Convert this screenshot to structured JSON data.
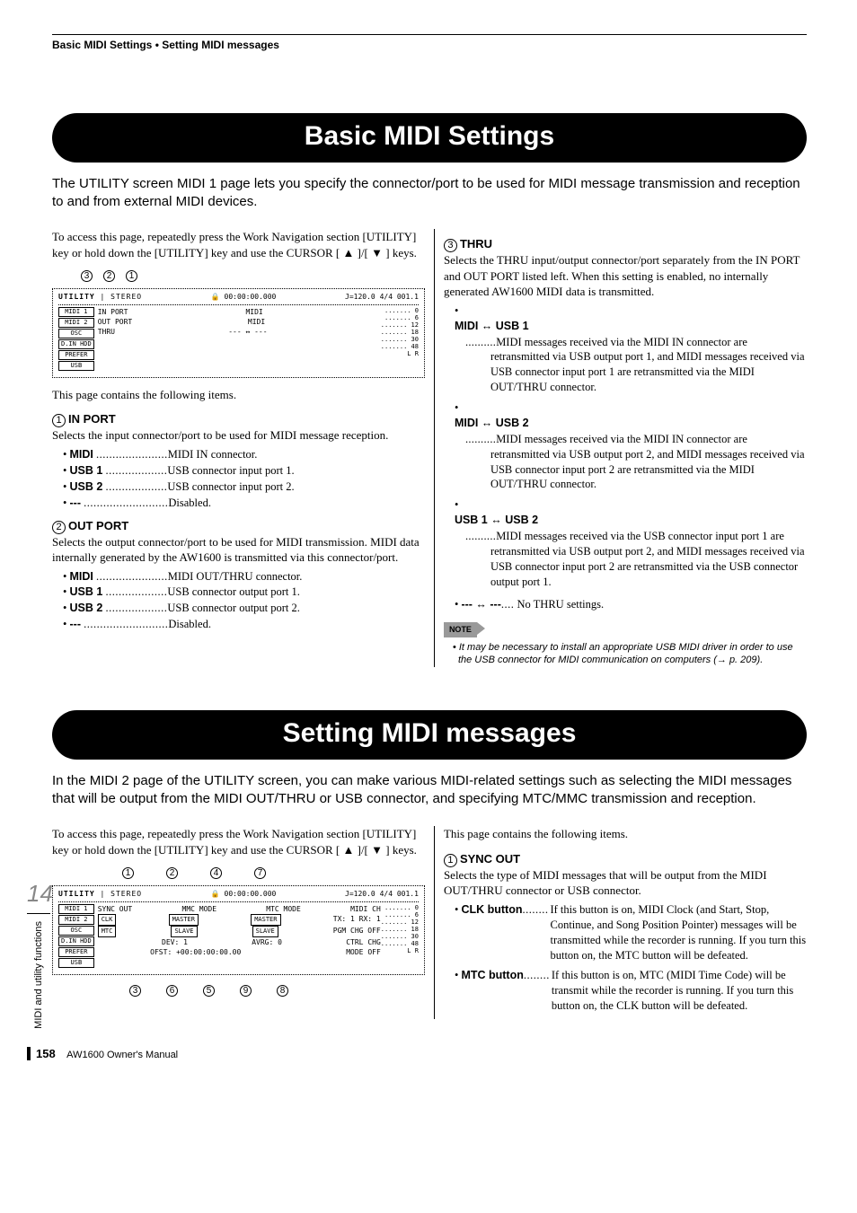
{
  "header": {
    "breadcrumb": "Basic MIDI Settings  •  Setting MIDI messages"
  },
  "chapter": {
    "number": "14",
    "label": "MIDI and utility functions"
  },
  "footer": {
    "page": "158",
    "manual": "AW1600 Owner's Manual"
  },
  "section1": {
    "title": "Basic MIDI Settings",
    "intro": "The UTILITY screen MIDI 1 page lets you specify the connector/port to be used for MIDI message transmission and reception to and from external MIDI devices.",
    "left": {
      "access": "To access this page, repeatedly press the Work Navigation section [UTILITY] key or hold down the [UTILITY] key and use the CURSOR [ ▲ ]/[ ▼ ] keys.",
      "callouts_top": [
        "3",
        "2",
        "1"
      ],
      "ss": {
        "title_left": "UTILITY",
        "title_mid": "STEREO",
        "title_time": "00:00:00.000",
        "title_right": "J=120.0 4/4 001.1",
        "tabs": [
          "MIDI 1",
          "MIDI 2",
          "OSC",
          "D.IN HDD",
          "PREFER",
          "USB"
        ],
        "rows": [
          [
            "IN PORT",
            "MIDI"
          ],
          [
            "OUT PORT",
            "MIDI"
          ],
          [
            "THRU",
            "---   ↔   ---"
          ]
        ],
        "meters": [
          "0",
          "6",
          "12",
          "18",
          "30",
          "48",
          "L R"
        ]
      },
      "after_ss": "This page contains the following items.",
      "items": [
        {
          "num": "1",
          "name": "IN PORT",
          "desc": "Selects the input connector/port to be used for MIDI message reception.",
          "dl": [
            {
              "term": "MIDI",
              "dots": "......................",
              "def": "MIDI IN connector."
            },
            {
              "term": "USB 1",
              "dots": "...................",
              "def": "USB connector input port 1."
            },
            {
              "term": "USB 2",
              "dots": "...................",
              "def": "USB connector input port 2."
            },
            {
              "term": "---",
              "dots": "..........................",
              "def": "Disabled."
            }
          ]
        },
        {
          "num": "2",
          "name": "OUT PORT",
          "desc": "Selects the output connector/port to be used for MIDI transmission. MIDI data internally generated by the AW1600 is transmitted via this connector/port.",
          "dl": [
            {
              "term": "MIDI",
              "dots": "......................",
              "def": "MIDI OUT/THRU connector."
            },
            {
              "term": "USB 1",
              "dots": "...................",
              "def": "USB connector output port 1."
            },
            {
              "term": "USB 2",
              "dots": "...................",
              "def": "USB connector output port 2."
            },
            {
              "term": "---",
              "dots": "..........................",
              "def": "Disabled."
            }
          ]
        }
      ]
    },
    "right": {
      "item": {
        "num": "3",
        "name": "THRU",
        "desc": "Selects the THRU input/output connector/port separately from the IN PORT and OUT PORT listed left. When this setting is enabled, no internally generated AW1600 MIDI data is transmitted.",
        "nested": [
          {
            "term": "MIDI ↔ USB 1",
            "def": "MIDI messages received via the MIDI IN connector are retransmitted via USB output port 1, and MIDI messages received via USB connector input port 1 are retransmitted via the MIDI OUT/THRU connector."
          },
          {
            "term": "MIDI ↔ USB 2",
            "def": "MIDI messages received via the MIDI IN connector are retransmitted via USB output port 2, and MIDI messages received via USB connector input port 2 are retransmitted via the MIDI OUT/THRU connector."
          },
          {
            "term": "USB 1 ↔ USB 2",
            "def": "MIDI messages received via the USB connector input port 1 are retransmitted via USB output port 2, and MIDI messages received via USB connector input port 2 are retransmitted via the USB connector output port 1."
          }
        ],
        "last": {
          "term": "--- ↔ ---",
          "dots": "....",
          "def": "No THRU settings."
        }
      },
      "note_label": "NOTE",
      "note": "It may be necessary to install an appropriate USB MIDI driver in order to use the USB connector for MIDI communication on computers (→ p. 209)."
    }
  },
  "section2": {
    "title": "Setting MIDI messages",
    "intro": "In the MIDI 2 page of the UTILITY screen, you can make various MIDI-related settings such as selecting the MIDI messages that will be output from the MIDI OUT/THRU or USB connector, and specifying MTC/MMC transmission and reception.",
    "left": {
      "access": "To access this page, repeatedly press the Work Navigation section [UTILITY] key or hold down the [UTILITY] key and use the CURSOR [ ▲ ]/[ ▼ ] keys.",
      "callouts_top": [
        "1",
        "2",
        "4",
        "7"
      ],
      "callouts_bottom": [
        "3",
        "6",
        "5",
        "9",
        "8"
      ],
      "ss": {
        "title_left": "UTILITY",
        "title_mid": "STEREO",
        "title_time": "00:00:00.000",
        "title_right": "J=120.0 4/4 001.1",
        "tabs": [
          "MIDI 1",
          "MIDI 2",
          "OSC",
          "D.IN HDD",
          "PREFER",
          "USB"
        ],
        "rows": [
          [
            "SYNC OUT",
            "MMC MODE",
            "MTC MODE",
            "MIDI CH"
          ],
          [
            "CLK",
            "MASTER",
            "MASTER",
            "TX: 1 RX: 1"
          ],
          [
            "MTC",
            "SLAVE",
            "SLAVE",
            "PGM CHG OFF"
          ],
          [
            "",
            "DEV: 1",
            "AVRG: 0",
            "CTRL CHG"
          ],
          [
            "",
            "OFST: +00:00:00:00.00",
            "",
            "MODE OFF"
          ]
        ],
        "meters": [
          "0",
          "6",
          "12",
          "18",
          "30",
          "48",
          "L R"
        ]
      }
    },
    "right": {
      "after": "This page contains the following items.",
      "item": {
        "num": "1",
        "name": "SYNC OUT",
        "desc": "Selects the type of MIDI messages that will be output from the MIDI OUT/THRU connector or USB connector.",
        "dl": [
          {
            "term": "CLK button",
            "dots": "........",
            "def": "If this button is on, MIDI Clock (and Start, Stop, Continue, and Song Position Pointer) messages will be transmitted while the recorder is running. If you turn this button on, the MTC button will be defeated."
          },
          {
            "term": "MTC button",
            "dots": "........",
            "def": "If this button is on, MTC (MIDI Time Code) will be transmit while the recorder is running. If you turn this button on, the CLK button will be defeated."
          }
        ]
      }
    }
  }
}
